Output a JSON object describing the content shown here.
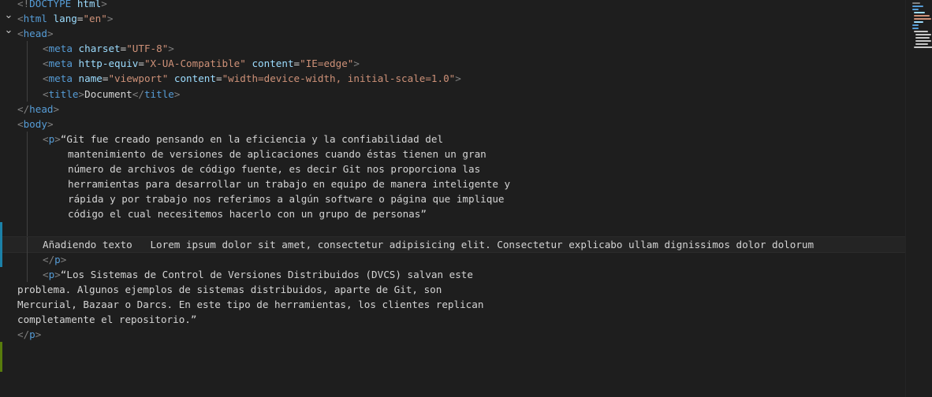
{
  "editor": {
    "language": "html",
    "colors": {
      "background": "#1e1e1e",
      "tag_bracket": "#808080",
      "tag_name": "#569cd6",
      "attribute": "#9cdcfe",
      "string": "#ce9178",
      "text": "#d4d4d4"
    },
    "lines": [
      {
        "fold": "",
        "indent": 0,
        "tokens": [
          {
            "t": "br",
            "v": "<!"
          },
          {
            "t": "tg",
            "v": "DOCTYPE"
          },
          {
            "t": "op",
            "v": " "
          },
          {
            "t": "at",
            "v": "html"
          },
          {
            "t": "br",
            "v": ">"
          }
        ]
      },
      {
        "fold": "chevron-down",
        "indent": 0,
        "tokens": [
          {
            "t": "br",
            "v": "<"
          },
          {
            "t": "tg",
            "v": "html"
          },
          {
            "t": "op",
            "v": " "
          },
          {
            "t": "at",
            "v": "lang"
          },
          {
            "t": "op",
            "v": "="
          },
          {
            "t": "st",
            "v": "\"en\""
          },
          {
            "t": "br",
            "v": ">"
          }
        ]
      },
      {
        "fold": "chevron-down",
        "indent": 0,
        "tokens": [
          {
            "t": "br",
            "v": "<"
          },
          {
            "t": "tg",
            "v": "head"
          },
          {
            "t": "br",
            "v": ">"
          }
        ]
      },
      {
        "fold": "",
        "indent": 1,
        "tokens": [
          {
            "t": "br",
            "v": "<"
          },
          {
            "t": "tg",
            "v": "meta"
          },
          {
            "t": "op",
            "v": " "
          },
          {
            "t": "at",
            "v": "charset"
          },
          {
            "t": "op",
            "v": "="
          },
          {
            "t": "st",
            "v": "\"UTF-8\""
          },
          {
            "t": "br",
            "v": ">"
          }
        ]
      },
      {
        "fold": "",
        "indent": 1,
        "tokens": [
          {
            "t": "br",
            "v": "<"
          },
          {
            "t": "tg",
            "v": "meta"
          },
          {
            "t": "op",
            "v": " "
          },
          {
            "t": "at",
            "v": "http-equiv"
          },
          {
            "t": "op",
            "v": "="
          },
          {
            "t": "st",
            "v": "\"X-UA-Compatible\""
          },
          {
            "t": "op",
            "v": " "
          },
          {
            "t": "at",
            "v": "content"
          },
          {
            "t": "op",
            "v": "="
          },
          {
            "t": "st",
            "v": "\"IE=edge\""
          },
          {
            "t": "br",
            "v": ">"
          }
        ]
      },
      {
        "fold": "",
        "indent": 1,
        "tokens": [
          {
            "t": "br",
            "v": "<"
          },
          {
            "t": "tg",
            "v": "meta"
          },
          {
            "t": "op",
            "v": " "
          },
          {
            "t": "at",
            "v": "name"
          },
          {
            "t": "op",
            "v": "="
          },
          {
            "t": "st",
            "v": "\"viewport\""
          },
          {
            "t": "op",
            "v": " "
          },
          {
            "t": "at",
            "v": "content"
          },
          {
            "t": "op",
            "v": "="
          },
          {
            "t": "st",
            "v": "\"width=device-width, initial-scale=1.0\""
          },
          {
            "t": "br",
            "v": ">"
          }
        ]
      },
      {
        "fold": "",
        "indent": 1,
        "tokens": [
          {
            "t": "br",
            "v": "<"
          },
          {
            "t": "tg",
            "v": "title"
          },
          {
            "t": "br",
            "v": ">"
          },
          {
            "t": "op",
            "v": "Document"
          },
          {
            "t": "br",
            "v": "</"
          },
          {
            "t": "tg",
            "v": "title"
          },
          {
            "t": "br",
            "v": ">"
          }
        ]
      },
      {
        "fold": "",
        "indent": 0,
        "tokens": [
          {
            "t": "br",
            "v": "</"
          },
          {
            "t": "tg",
            "v": "head"
          },
          {
            "t": "br",
            "v": ">"
          }
        ]
      },
      {
        "fold": "",
        "indent": 0,
        "tokens": [
          {
            "t": "br",
            "v": "<"
          },
          {
            "t": "tg",
            "v": "body"
          },
          {
            "t": "br",
            "v": ">"
          }
        ]
      },
      {
        "fold": "",
        "indent": 1,
        "tokens": [
          {
            "t": "br",
            "v": "<"
          },
          {
            "t": "tg",
            "v": "p"
          },
          {
            "t": "br",
            "v": ">"
          },
          {
            "t": "op",
            "v": "“Git fue creado pensando en la eficiencia y la confiabilidad del"
          }
        ]
      },
      {
        "fold": "",
        "indent": 2,
        "tokens": [
          {
            "t": "op",
            "v": "mantenimiento de versiones de aplicaciones cuando éstas tienen un gran"
          }
        ]
      },
      {
        "fold": "",
        "indent": 2,
        "tokens": [
          {
            "t": "op",
            "v": "número de archivos de código fuente, es decir Git nos proporciona las"
          }
        ]
      },
      {
        "fold": "",
        "indent": 2,
        "tokens": [
          {
            "t": "op",
            "v": "herramientas para desarrollar un trabajo en equipo de manera inteligente y"
          }
        ]
      },
      {
        "fold": "",
        "indent": 2,
        "tokens": [
          {
            "t": "op",
            "v": "rápida y por trabajo nos referimos a algún software o página que implique"
          }
        ]
      },
      {
        "fold": "",
        "indent": 2,
        "tokens": [
          {
            "t": "op",
            "v": "código el cual necesitemos hacerlo con un grupo de personas”"
          }
        ]
      },
      {
        "fold": "",
        "indent": 1,
        "tokens": []
      },
      {
        "fold": "",
        "indent": 1,
        "current": true,
        "tokens": [
          {
            "t": "op",
            "v": "Añadiendo texto   Lorem ipsum dolor sit amet, consectetur adipisicing elit. Consectetur explicabo ullam dignissimos dolor dolorum"
          }
        ]
      },
      {
        "fold": "",
        "indent": 1,
        "tokens": [
          {
            "t": "br",
            "v": "</"
          },
          {
            "t": "tg",
            "v": "p"
          },
          {
            "t": "br",
            "v": ">"
          }
        ]
      },
      {
        "fold": "",
        "indent": 1,
        "tokens": [
          {
            "t": "br",
            "v": "<"
          },
          {
            "t": "tg",
            "v": "p"
          },
          {
            "t": "br",
            "v": ">"
          },
          {
            "t": "op",
            "v": "“Los Sistemas de Control de Versiones Distribuidos (DVCS) salvan este"
          }
        ]
      },
      {
        "fold": "",
        "indent": 0,
        "tokens": [
          {
            "t": "op",
            "v": "problema. Algunos ejemplos de sistemas distribuidos, aparte de Git, son"
          }
        ]
      },
      {
        "fold": "",
        "indent": 0,
        "tokens": [
          {
            "t": "op",
            "v": "Mercurial, Bazaar o Darcs. En este tipo de herramientas, los clientes replican"
          }
        ]
      },
      {
        "fold": "",
        "indent": 0,
        "tokens": [
          {
            "t": "op",
            "v": "completamente el repositorio.”"
          }
        ]
      },
      {
        "fold": "",
        "indent": 0,
        "tokens": [
          {
            "t": "br",
            "v": "</"
          },
          {
            "t": "tg",
            "v": "p"
          },
          {
            "t": "br",
            "v": ">"
          }
        ]
      },
      {
        "fold": "",
        "indent": 0,
        "tokens": []
      }
    ]
  }
}
